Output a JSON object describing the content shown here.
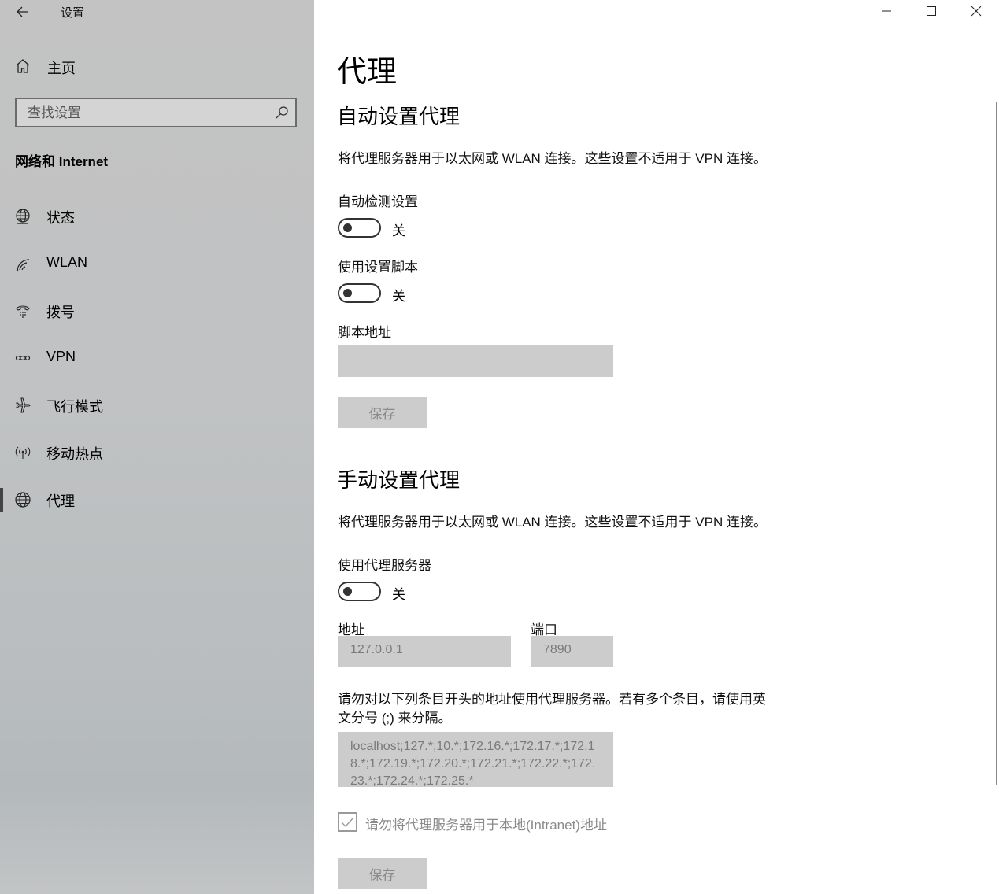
{
  "window": {
    "title": "设置"
  },
  "sidebar": {
    "home_label": "主页",
    "search_placeholder": "查找设置",
    "section_title": "网络和 Internet",
    "items": [
      {
        "label": "状态",
        "icon": "globe-status-icon"
      },
      {
        "label": "WLAN",
        "icon": "wifi-icon"
      },
      {
        "label": "拨号",
        "icon": "phone-dialup-icon"
      },
      {
        "label": "VPN",
        "icon": "vpn-icon"
      },
      {
        "label": "飞行模式",
        "icon": "airplane-icon"
      },
      {
        "label": "移动热点",
        "icon": "hotspot-icon"
      },
      {
        "label": "代理",
        "icon": "globe-icon",
        "active": true
      }
    ]
  },
  "main": {
    "title": "代理",
    "auto": {
      "heading": "自动设置代理",
      "description": "将代理服务器用于以太网或 WLAN 连接。这些设置不适用于 VPN 连接。",
      "detect_label": "自动检测设置",
      "detect_state": "关",
      "script_label": "使用设置脚本",
      "script_state": "关",
      "address_label": "脚本地址",
      "address_value": "",
      "save_label": "保存"
    },
    "manual": {
      "heading": "手动设置代理",
      "description": "将代理服务器用于以太网或 WLAN 连接。这些设置不适用于 VPN 连接。",
      "use_label": "使用代理服务器",
      "use_state": "关",
      "address_label": "地址",
      "address_value": "127.0.0.1",
      "port_label": "端口",
      "port_value": "7890",
      "exceptions_label_line1": "请勿对以下列条目开头的地址使用代理服务器。若有多个条目，请使用英",
      "exceptions_label_line2": "文分号 (;) 来分隔。",
      "exceptions_value": "localhost;127.*;10.*;172.16.*;172.17.*;172.18.*;172.19.*;172.20.*;172.21.*;172.22.*;172.23.*;172.24.*;172.25.*",
      "local_checkbox_label": "请勿将代理服务器用于本地(Intranet)地址",
      "local_checkbox_checked": true,
      "save_label": "保存"
    }
  }
}
